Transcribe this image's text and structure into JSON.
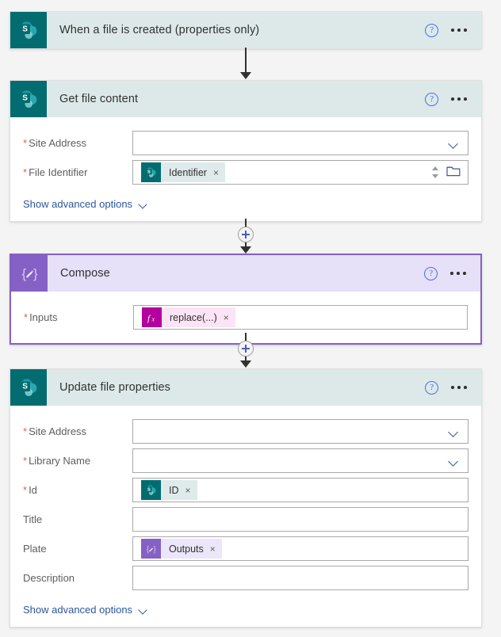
{
  "flow": {
    "cards": [
      {
        "id": "trigger-when-file-created",
        "title": "When a file is created (properties only)",
        "icon": "sharepoint-icon",
        "theme": "sp",
        "selected": false,
        "collapsed": true,
        "help_label": "?",
        "menu_label": "More commands"
      },
      {
        "id": "get-file-content",
        "title": "Get file content",
        "icon": "sharepoint-icon",
        "theme": "sp",
        "selected": false,
        "collapsed": false,
        "help_label": "?",
        "menu_label": "More commands",
        "fields": [
          {
            "label": "Site Address",
            "required": true,
            "control": "dropdown",
            "value": "",
            "placeholder": ""
          },
          {
            "label": "File Identifier",
            "required": true,
            "control": "token-picker",
            "token": {
              "text": "Identifier",
              "icon": "sharepoint-icon",
              "theme": "sp",
              "remove_label": "×"
            }
          }
        ],
        "advanced_options_label": "Show advanced options"
      },
      {
        "id": "compose",
        "title": "Compose",
        "icon": "compose-icon",
        "theme": "comp",
        "selected": true,
        "collapsed": false,
        "help_label": "?",
        "menu_label": "More commands",
        "fields": [
          {
            "label": "Inputs",
            "required": true,
            "control": "token",
            "token": {
              "text": "replace(...)",
              "icon": "function-icon",
              "theme": "fx",
              "remove_label": "×"
            }
          }
        ]
      },
      {
        "id": "update-file-properties",
        "title": "Update file properties",
        "icon": "sharepoint-icon",
        "theme": "sp",
        "selected": false,
        "collapsed": false,
        "help_label": "?",
        "menu_label": "More commands",
        "fields": [
          {
            "label": "Site Address",
            "required": true,
            "control": "dropdown",
            "value": "",
            "placeholder": ""
          },
          {
            "label": "Library Name",
            "required": true,
            "control": "dropdown",
            "value": "",
            "placeholder": ""
          },
          {
            "label": "Id",
            "required": true,
            "control": "token",
            "token": {
              "text": "ID",
              "icon": "sharepoint-icon",
              "theme": "sp",
              "remove_label": "×"
            }
          },
          {
            "label": "Title",
            "required": false,
            "control": "text",
            "value": "",
            "placeholder": ""
          },
          {
            "label": "Plate",
            "required": false,
            "control": "token",
            "token": {
              "text": "Outputs",
              "icon": "compose-icon",
              "theme": "comp",
              "remove_label": "×"
            }
          },
          {
            "label": "Description",
            "required": false,
            "control": "text",
            "value": "",
            "placeholder": ""
          }
        ],
        "advanced_options_label": "Show advanced options"
      }
    ],
    "connectors": [
      {
        "id": "conn-trigger-to-getfile",
        "has_plus": false
      },
      {
        "id": "conn-getfile-to-compose",
        "has_plus": true
      },
      {
        "id": "conn-compose-to-update",
        "has_plus": true
      }
    ]
  },
  "colors": {
    "sharepoint_teal": "#036c70",
    "sharepoint_header": "#dde9e9",
    "compose_purple": "#8661c5",
    "compose_header": "#e6e0f8",
    "function_magenta": "#b4009e",
    "required_red": "#e55c4a",
    "link_blue": "#2b579a",
    "selection_border": "#8661c5",
    "canvas_background": "#f4f4f4"
  }
}
